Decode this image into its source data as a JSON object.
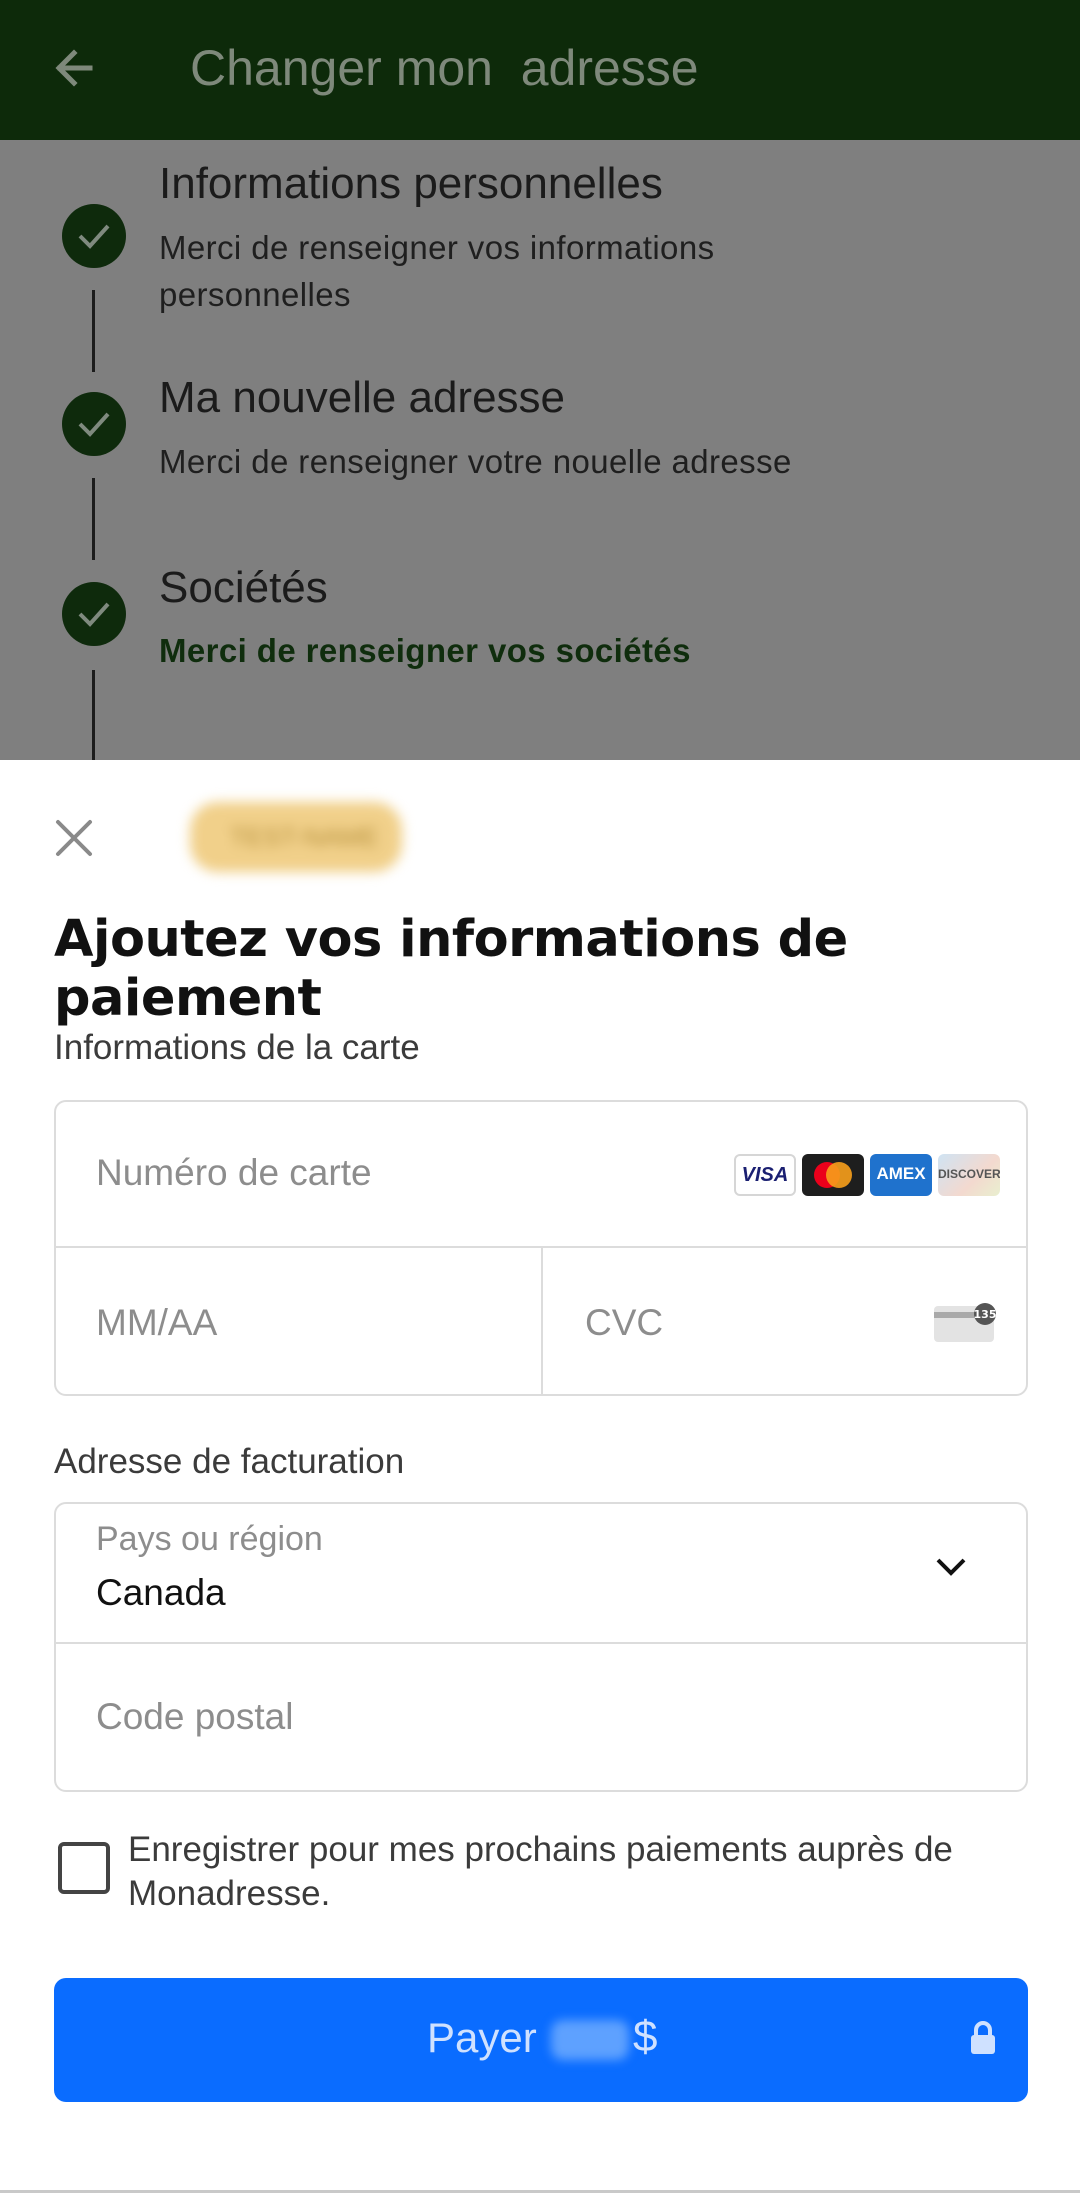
{
  "appbar": {
    "title": "Changer mon  adresse",
    "back_icon": "arrow-left-icon"
  },
  "steps": [
    {
      "title": "Informations personnelles",
      "description": "Merci de renseigner vos informations personnelles"
    },
    {
      "title": "Ma nouvelle adresse",
      "description": "Merci de renseigner votre nouelle adresse"
    },
    {
      "title": "Sociétés",
      "description": "Merci de renseigner vos sociétés"
    }
  ],
  "sheet": {
    "merchant_name": "TEST-NAME",
    "heading": "Ajoutez vos informations de paiement",
    "card_section_label": "Informations de la carte",
    "card_number_placeholder": "Numéro de carte",
    "card_brands": [
      "VISA",
      "mastercard",
      "AMEX",
      "DISCOVER"
    ],
    "expiry_placeholder": "MM/AA",
    "cvc_placeholder": "CVC",
    "cvc_badge": "135",
    "billing_section_label": "Adresse de facturation",
    "country_label": "Pays ou région",
    "country_value": "Canada",
    "postal_placeholder": "Code postal",
    "save_label": "Enregistrer pour mes prochains paiements auprès de Monadresse.",
    "pay_label": "Payer",
    "pay_currency": "$"
  },
  "colors": {
    "appbar": "#0d2a0a",
    "scrim": "#7f7f7f",
    "step_check": "#0e2a0c",
    "pay_button": "#0a6cff"
  }
}
